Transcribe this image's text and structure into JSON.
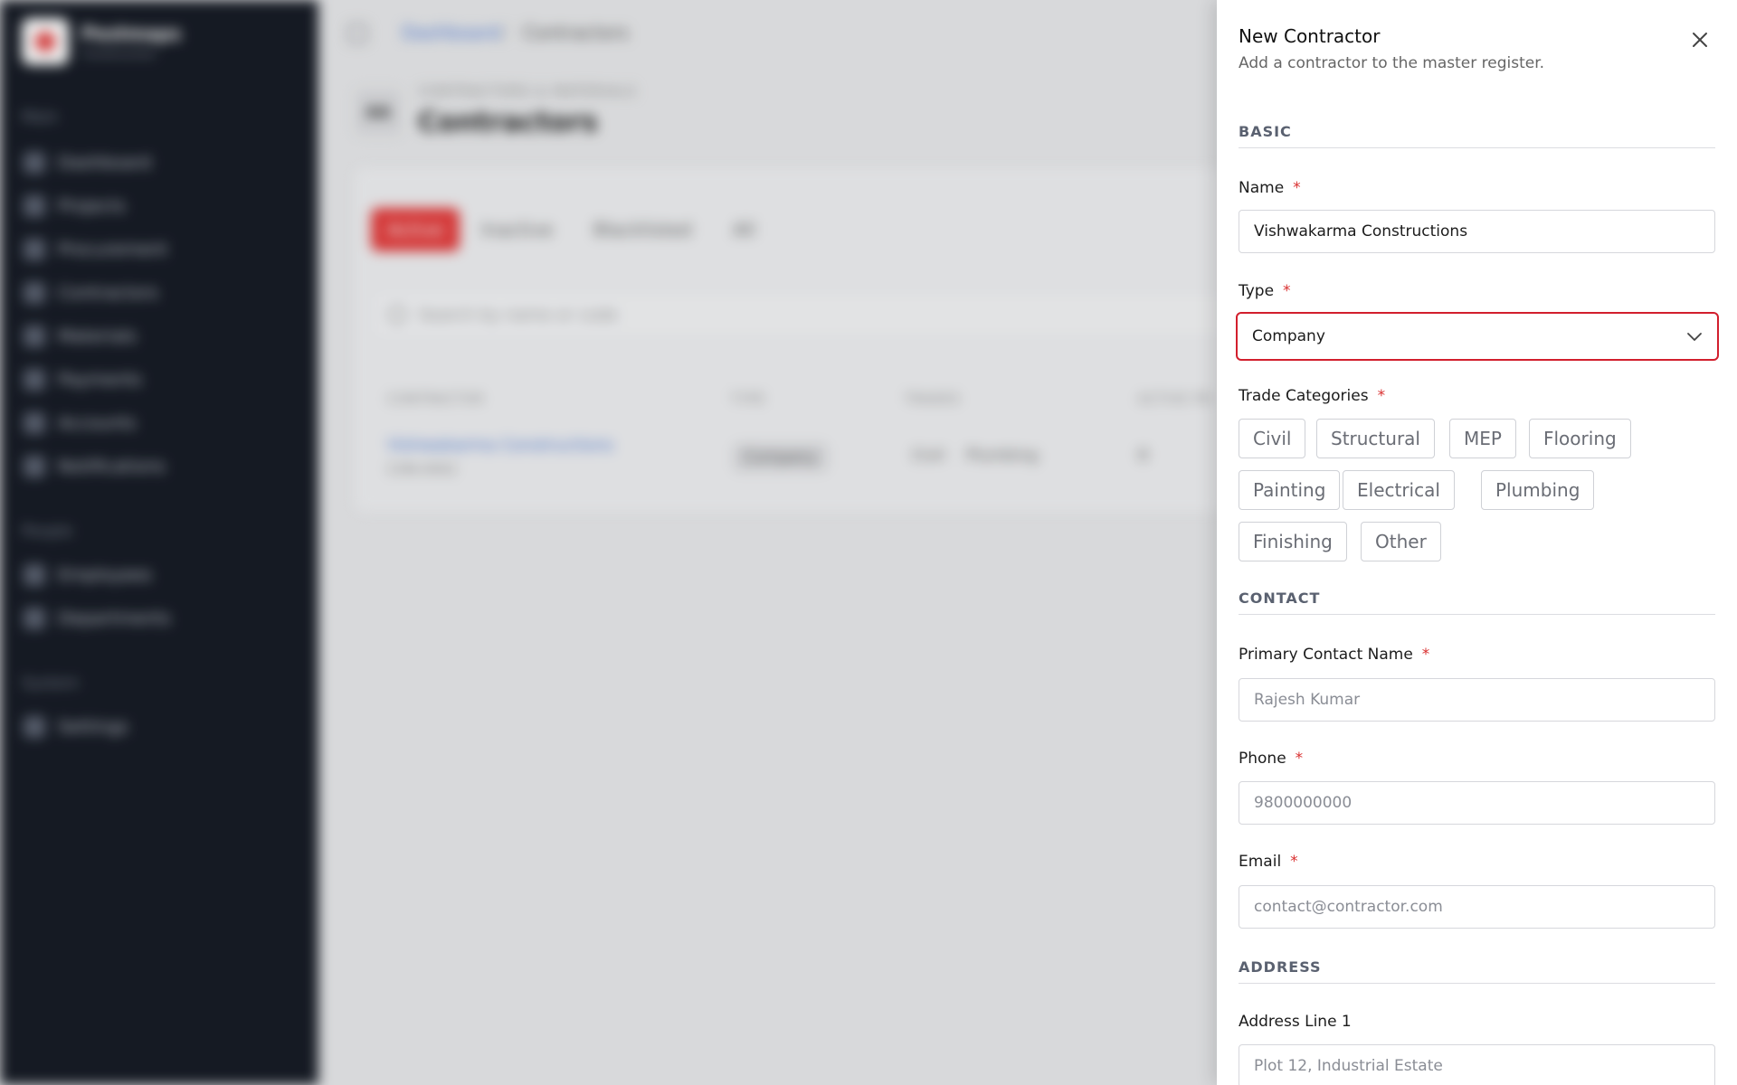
{
  "background": {
    "brand": {
      "name": "Pestmaps",
      "tagline": "Construction"
    },
    "nav_sections": [
      "Main",
      "People",
      "System"
    ],
    "nav_items": [
      "Dashboard",
      "Projects",
      "Procurement",
      "Contractors",
      "Materials",
      "Payments",
      "Accounts",
      "Notifications",
      "Employees",
      "Departments",
      "Settings"
    ],
    "breadcrumb": {
      "link": "Dashboard",
      "separator": "/",
      "current": "Contractors"
    },
    "page": {
      "eyebrow": "CONTRACTORS & MATERIALS",
      "title": "Contractors",
      "icon_text": "AA"
    },
    "tabs": [
      "Active",
      "Inactive",
      "Blacklisted",
      "All"
    ],
    "search_placeholder": "Search by name or code",
    "table": {
      "headers": [
        "CONTRACTOR",
        "TYPE",
        "TRADES",
        "ACTIVE PR"
      ],
      "rows": [
        {
          "name": "Vishwakarma Constructions",
          "code": "CON-0002",
          "type": "Company",
          "trades": [
            "Civil",
            "Plumbing"
          ],
          "active": "0"
        }
      ]
    }
  },
  "drawer": {
    "title": "New Contractor",
    "subtitle": "Add a contractor to the master register.",
    "required_mark": "*",
    "sections": {
      "basic": "BASIC",
      "contact": "CONTACT",
      "address": "ADDRESS"
    },
    "fields": {
      "name": {
        "label": "Name",
        "value": "Vishwakarma Constructions"
      },
      "type": {
        "label": "Type",
        "value": "Company"
      },
      "trade_categories": {
        "label": "Trade Categories",
        "options": [
          "Civil",
          "Structural",
          "MEP",
          "Flooring",
          "Painting",
          "Electrical",
          "Plumbing",
          "Finishing",
          "Other"
        ]
      },
      "primary_contact": {
        "label": "Primary Contact Name",
        "placeholder": "Rajesh Kumar"
      },
      "phone": {
        "label": "Phone",
        "placeholder": "9800000000"
      },
      "email": {
        "label": "Email",
        "placeholder": "contact@contractor.com"
      },
      "address_line1": {
        "label": "Address Line 1",
        "placeholder": "Plot 12, Industrial Estate"
      }
    },
    "icons": {
      "close": "close-icon",
      "dropdown": "chevron-down-icon"
    },
    "colors": {
      "accent": "#d21f2d",
      "required": "#d93030",
      "primary": "#e43a3a"
    }
  }
}
